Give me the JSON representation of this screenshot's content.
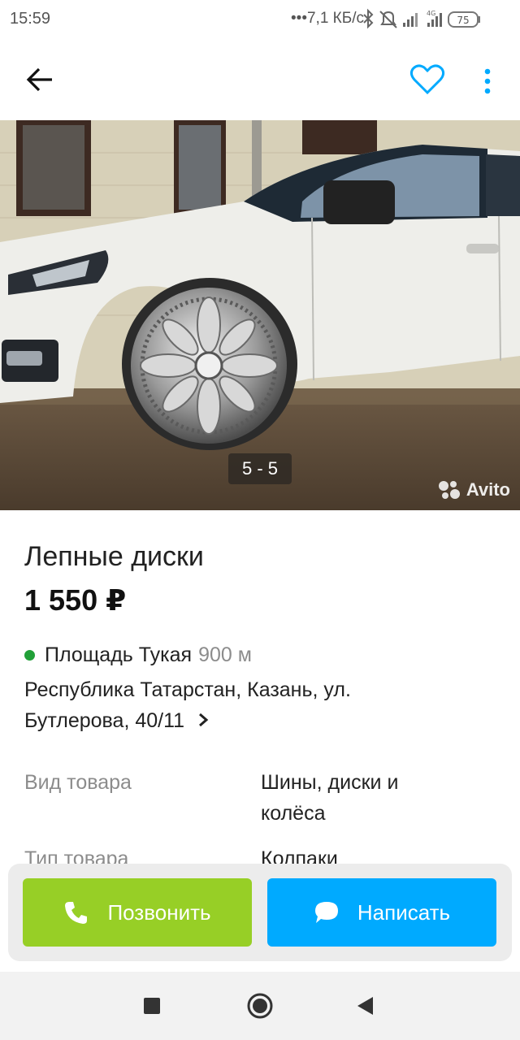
{
  "status_bar": {
    "time": "15:59",
    "network_speed": "•••7,1 КБ/с",
    "network_type": "4G",
    "battery_level": "75"
  },
  "app_bar": {
    "back_icon": "arrow-left-icon",
    "favorite_icon": "heart-outline-icon",
    "more_icon": "more-vertical-icon",
    "accent_color": "#00aaff"
  },
  "gallery": {
    "counter": "5 - 5",
    "watermark": "Avito"
  },
  "listing": {
    "title": "Лепные диски",
    "price": "1 550 ₽"
  },
  "location": {
    "metro_station": "Площадь Тукая",
    "metro_distance": "900 м",
    "metro_color": "#21a038",
    "address": "Республика Татарстан, Казань, ул. Бутлерова, 40/11"
  },
  "params": [
    {
      "label": "Вид товара",
      "value": "Шины, диски и колёса"
    },
    {
      "label": "Тип товара",
      "value": "Колпаки"
    }
  ],
  "actions": {
    "call_label": "Позвонить",
    "call_color": "#97cf26",
    "write_label": "Написать",
    "write_color": "#00aaff"
  },
  "nav_bar": {
    "recents_icon": "square-icon",
    "home_icon": "circle-icon",
    "back_icon": "triangle-back-icon"
  }
}
